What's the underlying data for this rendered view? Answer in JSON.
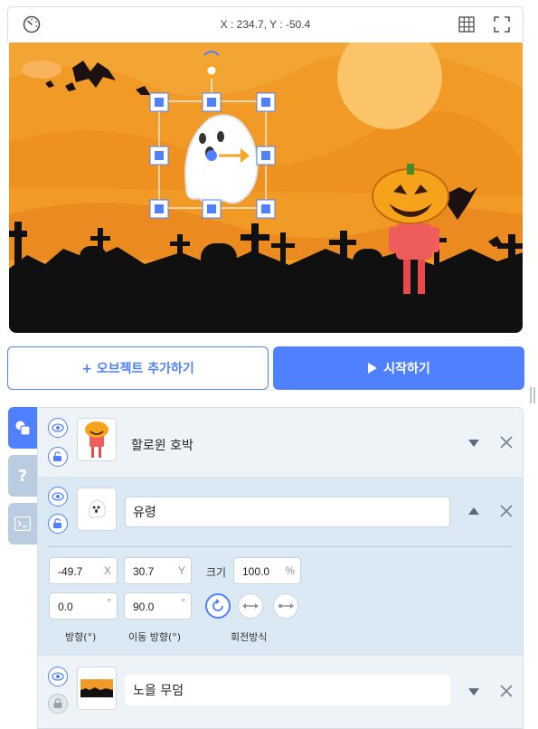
{
  "toolbar": {
    "coords": "X : 234.7, Y : -50.4",
    "speed_icon": "speedometer-icon",
    "grid_icon": "grid-icon",
    "fullscreen_icon": "fullscreen-icon"
  },
  "actions": {
    "add_object": "+ 오브젝트 추가하기",
    "start": "시작하기"
  },
  "side_tabs": {
    "objects_icon": "objects-icon",
    "help": "?",
    "console_icon": "console-icon"
  },
  "objects": [
    {
      "name": "할로윈 호박",
      "expanded": false,
      "locked": false
    },
    {
      "name": "유령",
      "expanded": true,
      "locked": false,
      "props": {
        "x": "-49.7",
        "x_unit": "X",
        "y": "30.7",
        "y_unit": "Y",
        "size_label": "크기",
        "size": "100.0",
        "size_unit": "%",
        "direction": "0.0",
        "direction_unit": "°",
        "move_direction": "90.0",
        "move_direction_unit": "°",
        "direction_label": "방향(°)",
        "move_direction_label": "이동 방향(°)",
        "rotation_label": "회전방식"
      }
    },
    {
      "name": "노을 무덤",
      "expanded": false,
      "locked": true
    }
  ],
  "colors": {
    "accent": "#4f80ff",
    "panel_bg": "#eef3f8",
    "selected_bg": "#dbe9f5",
    "sky": "#f19a26"
  }
}
